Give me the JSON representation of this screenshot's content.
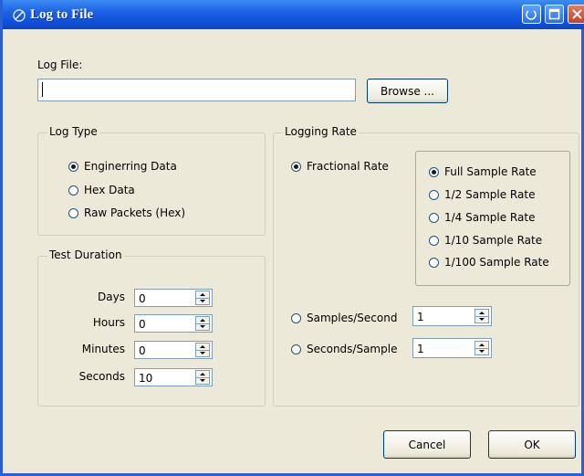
{
  "window": {
    "title": "Log to File",
    "colors": {
      "titlebar": "#0f4ed6",
      "face": "#ece9d8",
      "close": "#c4412a"
    }
  },
  "log_file": {
    "label": "Log File:",
    "value": "",
    "browse_label": "Browse ..."
  },
  "log_type": {
    "title": "Log Type",
    "options": [
      {
        "label": "Enginerring Data",
        "selected": true
      },
      {
        "label": "Hex Data",
        "selected": false
      },
      {
        "label": "Raw Packets (Hex)",
        "selected": false
      }
    ]
  },
  "test_duration": {
    "title": "Test Duration",
    "fields": [
      {
        "label": "Days",
        "value": "0"
      },
      {
        "label": "Hours",
        "value": "0"
      },
      {
        "label": "Minutes",
        "value": "0"
      },
      {
        "label": "Seconds",
        "value": "10"
      }
    ]
  },
  "logging_rate": {
    "title": "Logging Rate",
    "fractional_label": "Fractional Rate",
    "fractional_selected": true,
    "sample_rates": [
      {
        "label": "Full Sample Rate",
        "selected": true
      },
      {
        "label": "1/2 Sample Rate",
        "selected": false
      },
      {
        "label": "1/4 Sample Rate",
        "selected": false
      },
      {
        "label": "1/10 Sample Rate",
        "selected": false
      },
      {
        "label": "1/100 Sample Rate",
        "selected": false
      }
    ],
    "samples_per_second": {
      "label": "Samples/Second",
      "value": "1",
      "selected": false
    },
    "seconds_per_sample": {
      "label": "Seconds/Sample",
      "value": "1",
      "selected": false
    }
  },
  "buttons": {
    "cancel": "Cancel",
    "ok": "OK"
  }
}
